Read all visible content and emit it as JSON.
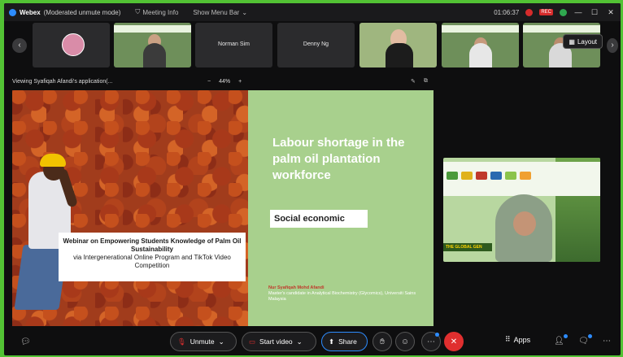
{
  "titlebar": {
    "app_name": "Webex",
    "mode": "(Moderated unmute mode)",
    "meeting_info": "Meeting Info",
    "menu_bar": "Show Menu Bar",
    "timer": "01:06:37",
    "rec_label": "REC"
  },
  "participants": [
    {
      "name": ""
    },
    {
      "name": ""
    },
    {
      "name": "Norman Sim"
    },
    {
      "name": "Denny Ng"
    },
    {
      "name": ""
    },
    {
      "name": ""
    },
    {
      "name": ""
    }
  ],
  "layout_button": "Layout",
  "share": {
    "viewing": "Viewing Syafiqah Afandi's application(...",
    "zoom_minus": "−",
    "zoom_level": "44%",
    "zoom_plus": "+"
  },
  "slide": {
    "title": "Labour shortage in the palm oil plantation workforce",
    "subtitle": "Social economic",
    "caption_bold": "Webinar on Empowering Students Knowledge of Palm Oil Sustainability",
    "caption_rest": "via Intergenerational Online Program and TikTok Video Competition",
    "presenter_name": "Nur Syafiqah Mohd Afandi",
    "presenter_desc": "Master's candidate in Analytical Biochemistry (Glycomics), Universiti Sains Malaysia"
  },
  "speaker_video": {
    "banner_text": "THE GLOBAL GEN"
  },
  "controls": {
    "unmute": "Unmute",
    "start_video": "Start video",
    "share": "Share",
    "apps": "Apps"
  },
  "colors": {
    "accent": "#2d8cff",
    "end": "#e02f2f",
    "slide_green": "#a8d08d",
    "outer": "#52c234"
  }
}
